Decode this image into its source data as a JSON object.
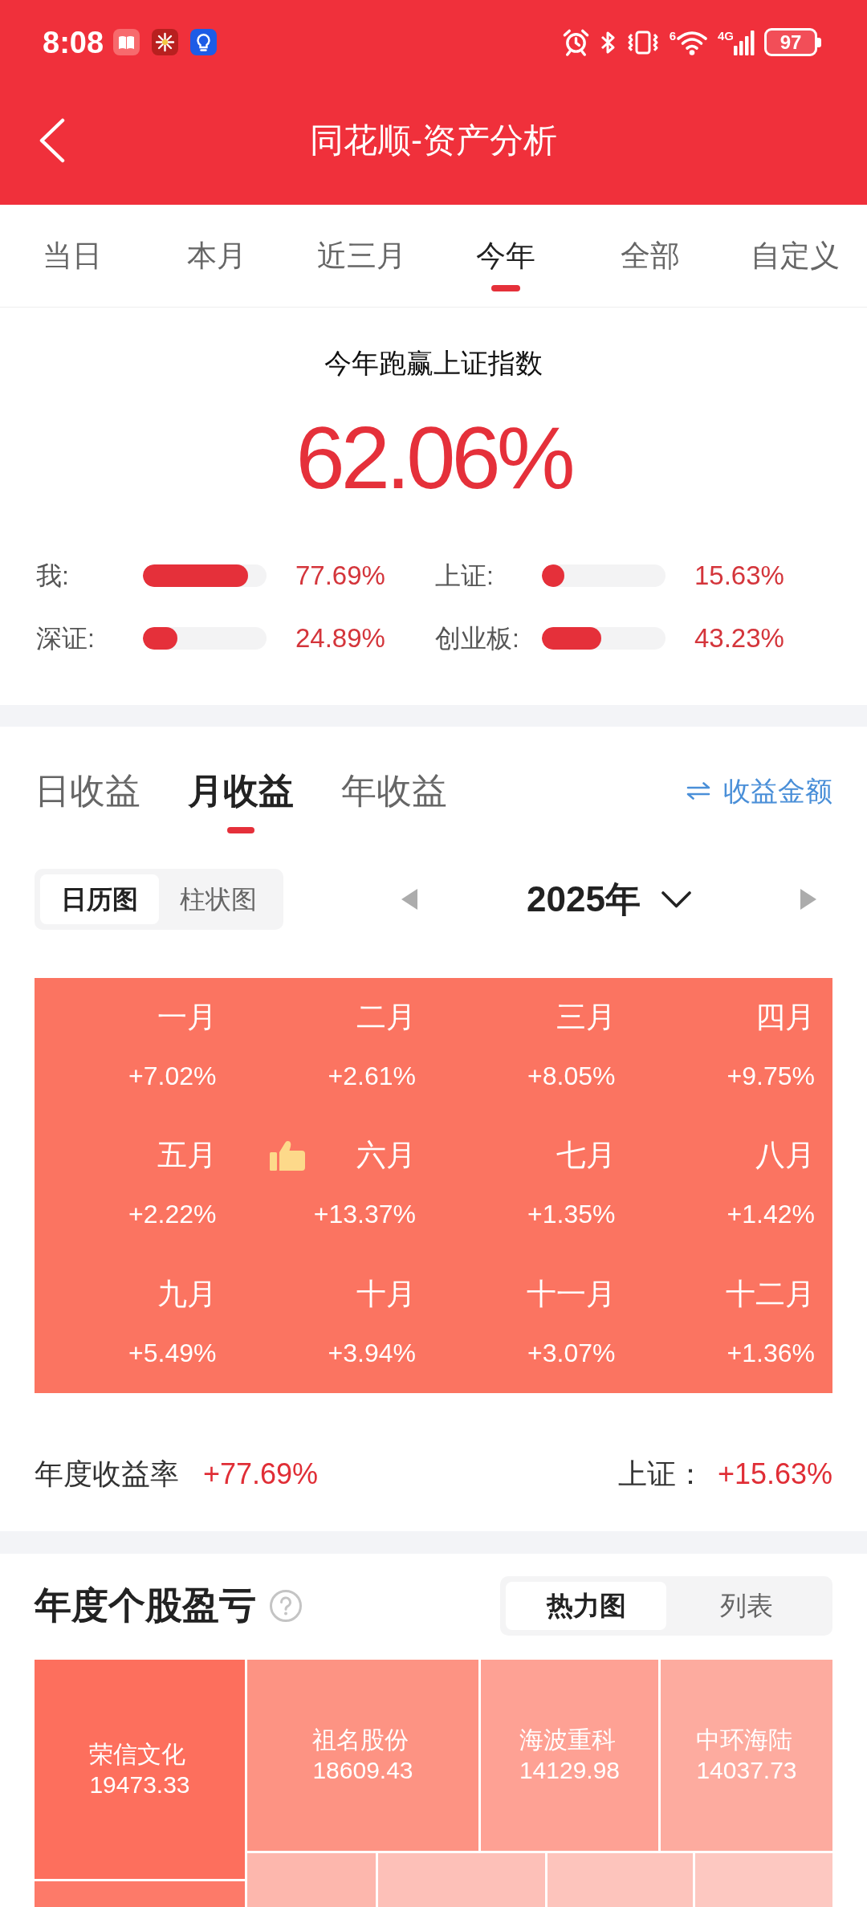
{
  "status_bar": {
    "time": "8:08",
    "wifi_label": "6",
    "network": "4G",
    "battery": "97"
  },
  "header": {
    "title": "同花顺-资产分析"
  },
  "period_tabs": [
    {
      "label": "当日",
      "selected": false
    },
    {
      "label": "本月",
      "selected": false
    },
    {
      "label": "近三月",
      "selected": false
    },
    {
      "label": "今年",
      "selected": true
    },
    {
      "label": "全部",
      "selected": false
    },
    {
      "label": "自定义",
      "selected": false
    }
  ],
  "summary": {
    "headline": "今年跑赢上证指数",
    "value": "62.06%",
    "comparisons": [
      {
        "label": "我:",
        "level": 0.85,
        "reading": "77.69%"
      },
      {
        "label": "上证:",
        "level": 0.18,
        "reading": "15.63%"
      },
      {
        "label": "深证:",
        "level": 0.28,
        "reading": "24.89%"
      },
      {
        "label": "创业板:",
        "level": 0.48,
        "reading": "43.23%"
      }
    ]
  },
  "returns": {
    "tabs": [
      {
        "label": "日收益",
        "selected": false
      },
      {
        "label": "月收益",
        "selected": true
      },
      {
        "label": "年收益",
        "selected": false
      }
    ],
    "toggle_link": "收益金额",
    "views": [
      {
        "label": "日历图",
        "selected": true
      },
      {
        "label": "柱状图",
        "selected": false
      }
    ],
    "year": "2025年",
    "months": [
      {
        "name": "一月",
        "change": "+7.02%",
        "best": false
      },
      {
        "name": "二月",
        "change": "+2.61%",
        "best": false
      },
      {
        "name": "三月",
        "change": "+8.05%",
        "best": false
      },
      {
        "name": "四月",
        "change": "+9.75%",
        "best": false
      },
      {
        "name": "五月",
        "change": "+2.22%",
        "best": false
      },
      {
        "name": "六月",
        "change": "+13.37%",
        "best": true
      },
      {
        "name": "七月",
        "change": "+1.35%",
        "best": false
      },
      {
        "name": "八月",
        "change": "+1.42%",
        "best": false
      },
      {
        "name": "九月",
        "change": "+5.49%",
        "best": false
      },
      {
        "name": "十月",
        "change": "+3.94%",
        "best": false
      },
      {
        "name": "十一月",
        "change": "+3.07%",
        "best": false
      },
      {
        "name": "十二月",
        "change": "+1.36%",
        "best": false
      }
    ],
    "annual_label": "年度收益率",
    "annual_value": "+77.69%",
    "index_label": "上证：",
    "index_value": "+15.63%"
  },
  "stocks": {
    "title": "年度个股盈亏",
    "views": [
      {
        "label": "热力图",
        "selected": true
      },
      {
        "label": "列表",
        "selected": false
      }
    ],
    "tiles": [
      {
        "name": "荣信文化",
        "value": "19473.33",
        "color": "#fd6f5d"
      },
      {
        "name": "祖名股份",
        "value": "18609.43",
        "color": "#fd9383"
      },
      {
        "name": "海波重科",
        "value": "14129.98",
        "color": "#fea194"
      },
      {
        "name": "中环海陆",
        "value": "14037.73",
        "color": "#fdab9f"
      },
      {
        "color": "#fd7a69"
      },
      {
        "color": "#fdb7ad"
      },
      {
        "color": "#fdc0b8"
      },
      {
        "color": "#fdc4bc"
      },
      {
        "color": "#fdc8c1"
      }
    ]
  }
}
